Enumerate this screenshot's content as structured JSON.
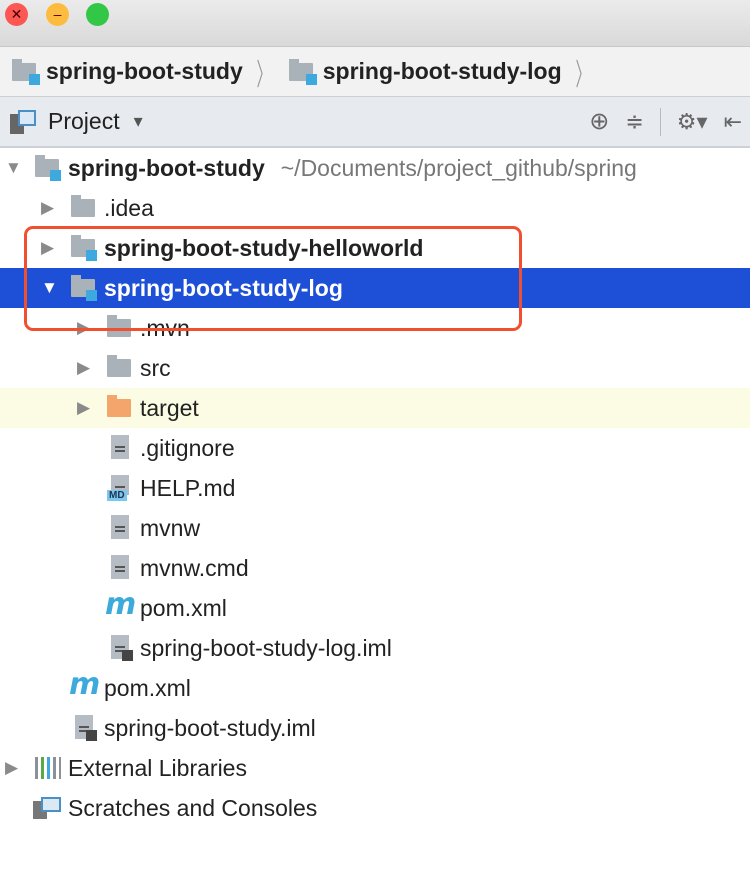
{
  "window": {
    "controls": [
      "close",
      "minimize",
      "fullscreen"
    ]
  },
  "breadcrumb": {
    "items": [
      "spring-boot-study",
      "spring-boot-study-log"
    ]
  },
  "toolbar": {
    "view_label": "Project",
    "view_dropdown": "▾"
  },
  "tree": [
    {
      "label": "spring-boot-study",
      "hint": "~/Documents/project_github/spring",
      "level": 0,
      "icon": "module-folder",
      "arrow": "down",
      "bold": true
    },
    {
      "label": ".idea",
      "level": 1,
      "icon": "folder",
      "arrow": "right"
    },
    {
      "label": "spring-boot-study-helloworld",
      "level": 1,
      "icon": "module-folder",
      "arrow": "right",
      "bold": true
    },
    {
      "label": "spring-boot-study-log",
      "level": 1,
      "icon": "module-folder",
      "arrow": "down",
      "bold": true,
      "selected": true
    },
    {
      "label": ".mvn",
      "level": 2,
      "icon": "folder",
      "arrow": "right"
    },
    {
      "label": "src",
      "level": 2,
      "icon": "folder",
      "arrow": "right"
    },
    {
      "label": "target",
      "level": 2,
      "icon": "excluded-folder",
      "arrow": "right",
      "excluded": true
    },
    {
      "label": ".gitignore",
      "level": 2,
      "icon": "text-file"
    },
    {
      "label": "HELP.md",
      "level": 2,
      "icon": "markdown-file"
    },
    {
      "label": "mvnw",
      "level": 2,
      "icon": "text-file"
    },
    {
      "label": "mvnw.cmd",
      "level": 2,
      "icon": "text-file"
    },
    {
      "label": "pom.xml",
      "level": 2,
      "icon": "maven-file"
    },
    {
      "label": "spring-boot-study-log.iml",
      "level": 2,
      "icon": "iml-file"
    },
    {
      "label": "pom.xml",
      "level": 1,
      "icon": "maven-file"
    },
    {
      "label": "spring-boot-study.iml",
      "level": 1,
      "icon": "iml-file"
    },
    {
      "label": "External Libraries",
      "level": 0,
      "icon": "libraries",
      "arrow": "right"
    },
    {
      "label": "Scratches and Consoles",
      "level": 0,
      "icon": "scratches"
    }
  ],
  "colors": {
    "selection": "#1d4fd7",
    "highlight_box": "#f0502f",
    "excluded_bg": "#fcfbe3"
  }
}
